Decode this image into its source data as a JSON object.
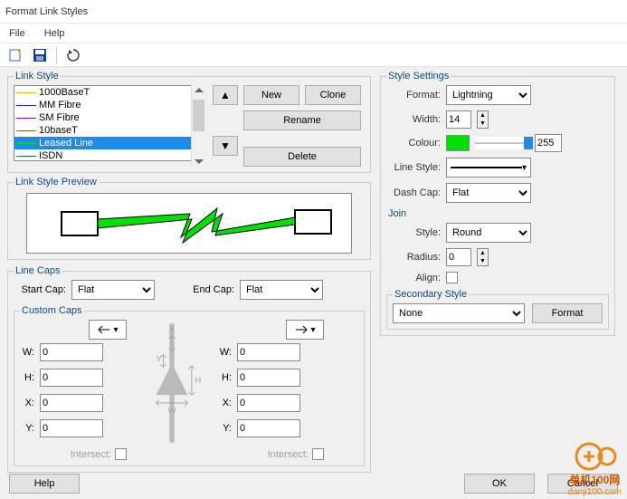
{
  "window": {
    "title": "Format Link Styles"
  },
  "menubar": {
    "file": "File",
    "help": "Help"
  },
  "left": {
    "link_style_legend": "Link Style",
    "items": [
      {
        "label": "1000BaseT",
        "color": "#e5b100"
      },
      {
        "label": "MM Fibre",
        "color": "#2020c0"
      },
      {
        "label": "SM Fibre",
        "color": "#7a0e9e"
      },
      {
        "label": "10baseT",
        "color": "#8c5a1e"
      },
      {
        "label": "Leased Line",
        "color": "#00e000",
        "selected": true
      },
      {
        "label": "ISDN",
        "color": "#0e7a2a"
      }
    ],
    "new": "New",
    "clone": "Clone",
    "rename": "Rename",
    "delete": "Delete",
    "preview_legend": "Link Style Preview",
    "caps_legend": "Line Caps",
    "start_cap_label": "Start Cap:",
    "start_cap": "Flat",
    "end_cap_label": "End Cap:",
    "end_cap": "Flat",
    "custom_caps_legend": "Custom Caps",
    "W": "W:",
    "H": "H:",
    "X": "X:",
    "Y": "Y:",
    "w1": "0",
    "h1": "0",
    "x1": "0",
    "y1": "0",
    "w2": "0",
    "h2": "0",
    "x2": "0",
    "y2": "0",
    "intersect": "Intersect:",
    "mid_X": "X",
    "mid_Y": "Y",
    "mid_H": "H",
    "mid_W": "W"
  },
  "right": {
    "settings_legend": "Style Settings",
    "format_label": "Format:",
    "format": "Lightning",
    "width_label": "Width:",
    "width": "14",
    "colour_label": "Colour:",
    "colour": "#00e000",
    "colour_alpha": "255",
    "linestyle_label": "Line Style:",
    "dashcap_label": "Dash Cap:",
    "dashcap": "Flat",
    "join_legend": "Join",
    "style_label": "Style:",
    "join_style": "Round",
    "radius_label": "Radius:",
    "radius": "0",
    "align_label": "Align:",
    "secondary_legend": "Secondary Style",
    "secondary": "None",
    "format_btn": "Format"
  },
  "footer": {
    "help": "Help",
    "ok": "OK",
    "cancel": "Cancel"
  },
  "watermark": {
    "site": "单机100网",
    "url": "danji100.com"
  }
}
